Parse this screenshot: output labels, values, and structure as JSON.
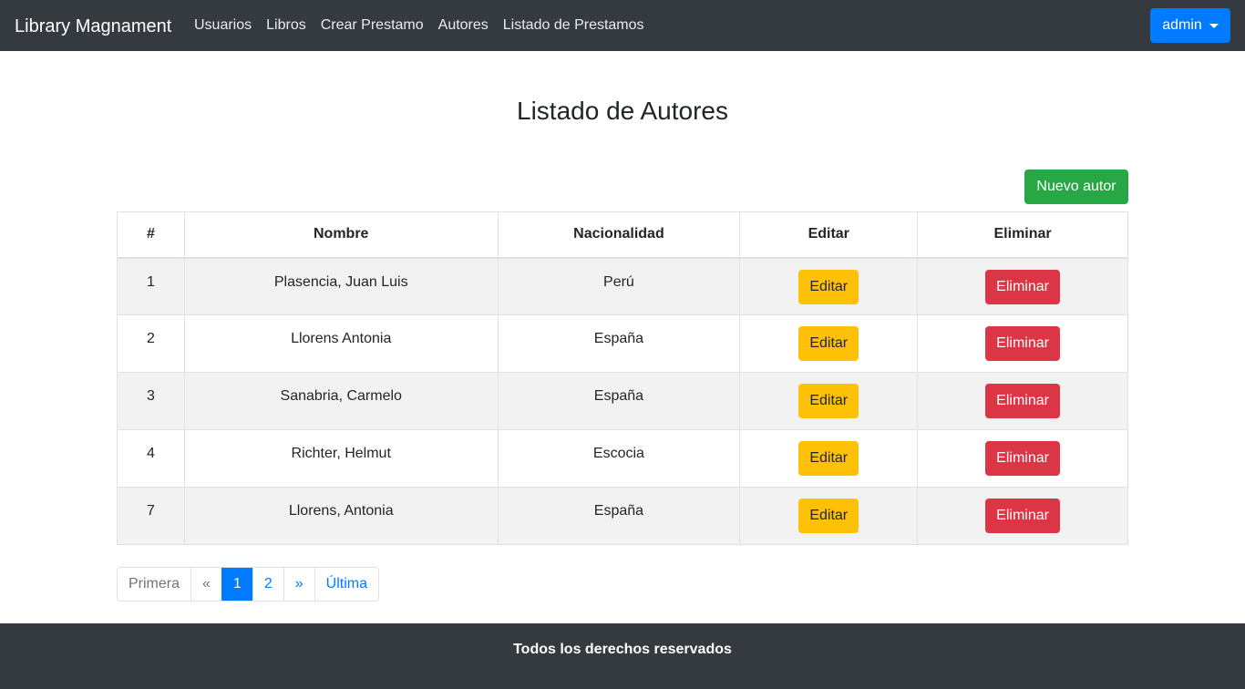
{
  "navbar": {
    "brand": "Library Magnament",
    "links": [
      {
        "label": "Usuarios"
      },
      {
        "label": "Libros"
      },
      {
        "label": "Crear Prestamo"
      },
      {
        "label": "Autores"
      },
      {
        "label": "Listado de Prestamos"
      }
    ],
    "user_button": "admin"
  },
  "page": {
    "title": "Listado de Autores",
    "new_button": "Nuevo autor"
  },
  "table": {
    "headers": [
      "#",
      "Nombre",
      "Nacionalidad",
      "Editar",
      "Eliminar"
    ],
    "rows": [
      {
        "id": "1",
        "name": "Plasencia, Juan Luis",
        "nationality": "Perú",
        "edit": "Editar",
        "delete": "Eliminar"
      },
      {
        "id": "2",
        "name": "Llorens Antonia",
        "nationality": "España",
        "edit": "Editar",
        "delete": "Eliminar"
      },
      {
        "id": "3",
        "name": "Sanabria, Carmelo",
        "nationality": "España",
        "edit": "Editar",
        "delete": "Eliminar"
      },
      {
        "id": "4",
        "name": "Richter, Helmut",
        "nationality": "Escocia",
        "edit": "Editar",
        "delete": "Eliminar"
      },
      {
        "id": "7",
        "name": "Llorens, Antonia",
        "nationality": "España",
        "edit": "Editar",
        "delete": "Eliminar"
      }
    ]
  },
  "pagination": {
    "first": "Primera",
    "prev": "«",
    "pages": [
      "1",
      "2"
    ],
    "next": "»",
    "last": "Última",
    "current": "1"
  },
  "footer": {
    "text": "Todos los derechos reservados"
  },
  "colors": {
    "navbar_bg": "#343a40",
    "primary": "#007bff",
    "success": "#28a745",
    "warning": "#ffc107",
    "danger": "#dc3545",
    "stripe": "#f2f2f2"
  }
}
